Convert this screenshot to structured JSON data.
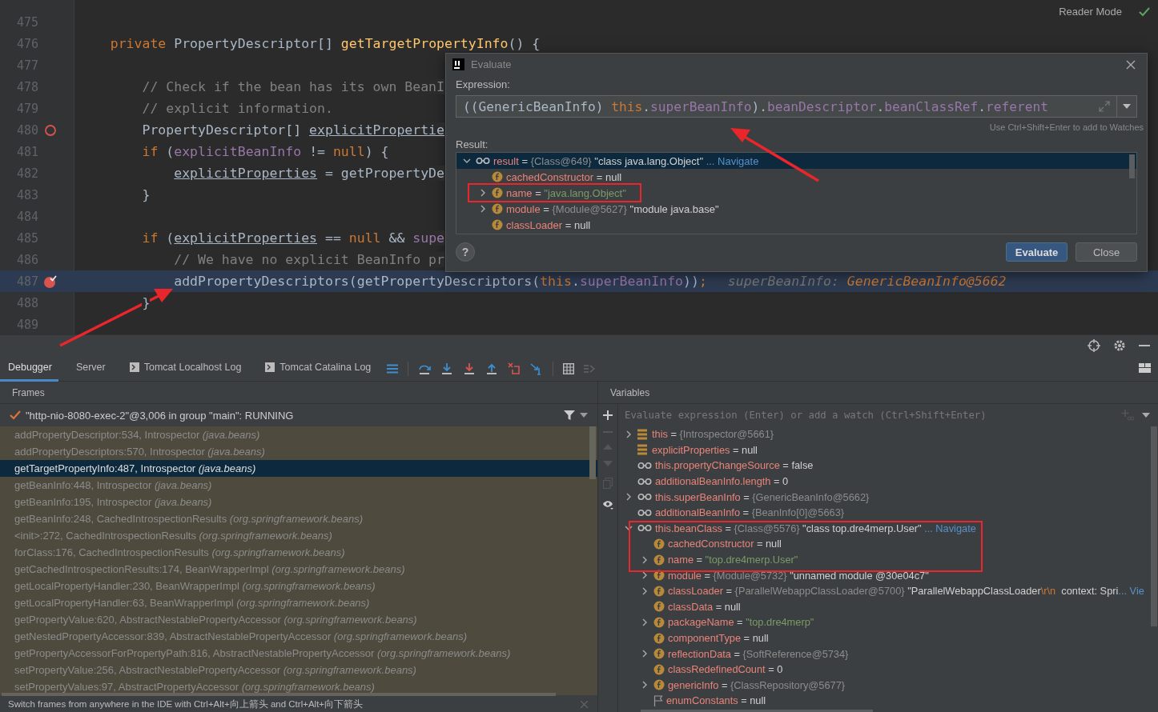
{
  "editor": {
    "reader_mode": "Reader Mode",
    "lines": [
      {
        "num": "475",
        "current": false
      },
      {
        "num": "476",
        "current": false,
        "tokens": [
          {
            "kind": "keyword",
            "t": "    private "
          },
          {
            "kind": "plain",
            "t": "PropertyDescriptor[] "
          },
          {
            "kind": "method",
            "t": "getTargetPropertyInfo"
          },
          {
            "kind": "plain",
            "t": "() {"
          }
        ]
      },
      {
        "num": "477",
        "current": false
      },
      {
        "num": "478",
        "current": false,
        "tokens": [
          {
            "kind": "comment",
            "t": "        // Check if the bean has its own BeanI"
          }
        ]
      },
      {
        "num": "479",
        "current": false,
        "tokens": [
          {
            "kind": "comment",
            "t": "        // explicit information."
          }
        ]
      },
      {
        "num": "480",
        "current": false,
        "breakpoint": true,
        "muted": true,
        "tokens": [
          {
            "kind": "plain",
            "t": "        PropertyDescriptor[] "
          },
          {
            "kind": "underline",
            "t": "explicitPropertie"
          }
        ]
      },
      {
        "num": "481",
        "current": false,
        "tokens": [
          {
            "kind": "keyword",
            "t": "        if "
          },
          {
            "kind": "plain",
            "t": "("
          },
          {
            "kind": "field",
            "t": "explicitBeanInfo"
          },
          {
            "kind": "plain",
            "t": " != "
          },
          {
            "kind": "keyword",
            "t": "null"
          },
          {
            "kind": "plain",
            "t": ") {"
          }
        ]
      },
      {
        "num": "482",
        "current": false,
        "tokens": [
          {
            "kind": "underline",
            "t": "            explicitProperties"
          },
          {
            "kind": "plain",
            "t": " = getPropertyDe"
          }
        ]
      },
      {
        "num": "483",
        "current": false,
        "tokens": [
          {
            "kind": "plain",
            "t": "        }"
          }
        ]
      },
      {
        "num": "484",
        "current": false
      },
      {
        "num": "485",
        "current": false,
        "tokens": [
          {
            "kind": "keyword",
            "t": "        if "
          },
          {
            "kind": "plain",
            "t": "("
          },
          {
            "kind": "underline",
            "t": "explicitProperties"
          },
          {
            "kind": "plain",
            "t": " == "
          },
          {
            "kind": "keyword",
            "t": "null"
          },
          {
            "kind": "plain",
            "t": " && "
          },
          {
            "kind": "field",
            "t": "supe"
          }
        ]
      },
      {
        "num": "486",
        "current": false,
        "tokens": [
          {
            "kind": "comment",
            "t": "            // We have no explicit BeanInfo pr"
          }
        ]
      },
      {
        "num": "487",
        "current": true,
        "breakpoint": true,
        "muted": false,
        "tokens": [
          {
            "kind": "plain",
            "t": "            addPropertyDescriptors(getPropertyDescriptors("
          },
          {
            "kind": "keyword",
            "t": "this"
          },
          {
            "kind": "plain",
            "t": "."
          },
          {
            "kind": "field",
            "t": "superBeanInfo"
          },
          {
            "kind": "plain",
            "t": "))"
          },
          {
            "kind": "keyword",
            "t": ";"
          },
          {
            "kind": "hint",
            "t": "superBeanInfo: "
          },
          {
            "kind": "hint-value",
            "t": "GenericBeanInfo@5662"
          }
        ]
      },
      {
        "num": "488",
        "current": false,
        "tokens": [
          {
            "kind": "plain",
            "t": "        }"
          }
        ]
      },
      {
        "num": "489",
        "current": false
      }
    ]
  },
  "dialog": {
    "title": "Evaluate",
    "expression_label": "Expression:",
    "expression": [
      {
        "kind": "plain",
        "t": "((GenericBeanInfo) "
      },
      {
        "kind": "keyword",
        "t": "this"
      },
      {
        "kind": "plain",
        "t": "."
      },
      {
        "kind": "field",
        "t": "superBeanInfo"
      },
      {
        "kind": "plain",
        "t": ")."
      },
      {
        "kind": "field",
        "t": "beanDescriptor"
      },
      {
        "kind": "plain",
        "t": "."
      },
      {
        "kind": "field",
        "t": "beanClassRef"
      },
      {
        "kind": "plain",
        "t": "."
      },
      {
        "kind": "field",
        "t": "referent"
      }
    ],
    "watch_hint": "Use Ctrl+Shift+Enter to add to Watches",
    "result_label": "Result:",
    "result": [
      {
        "kind": "watch",
        "name": "result",
        "expandable": true,
        "expanded": true,
        "selected": true,
        "value": [
          {
            "kind": "op",
            "t": " = "
          },
          {
            "kind": "ref",
            "t": "{Class@649} "
          },
          {
            "kind": "plain",
            "t": "\"class java.lang.Object\" "
          },
          {
            "kind": "link",
            "t": "... Navigate"
          }
        ],
        "children": [
          {
            "kind": "field",
            "name": "cachedConstructor",
            "expandable": false,
            "selected": false,
            "value": [
              {
                "kind": "op",
                "t": " = "
              },
              {
                "kind": "plain",
                "t": "null"
              }
            ]
          },
          {
            "kind": "field",
            "name": "name",
            "expandable": true,
            "expanded": false,
            "selected": false,
            "value": [
              {
                "kind": "op",
                "t": " = "
              },
              {
                "kind": "string",
                "t": "\"java.lang.Object\""
              }
            ]
          },
          {
            "kind": "field",
            "name": "module",
            "expandable": true,
            "expanded": false,
            "selected": false,
            "value": [
              {
                "kind": "op",
                "t": " = "
              },
              {
                "kind": "ref",
                "t": "{Module@5627} "
              },
              {
                "kind": "plain",
                "t": "\"module java.base\""
              }
            ]
          },
          {
            "kind": "field",
            "name": "classLoader",
            "expandable": false,
            "selected": false,
            "value": [
              {
                "kind": "op",
                "t": " = "
              },
              {
                "kind": "plain",
                "t": "null"
              }
            ]
          }
        ]
      }
    ],
    "buttons": [
      {
        "label": "Evaluate",
        "primary": true
      },
      {
        "label": "Close",
        "primary": false
      }
    ],
    "help": "?"
  },
  "debug": {
    "tabs": [
      {
        "label": "Debugger",
        "selected": true,
        "console": false
      },
      {
        "label": "Server",
        "selected": false,
        "console": false
      },
      {
        "label": "Tomcat Localhost Log",
        "selected": false,
        "console": true
      },
      {
        "label": "Tomcat Catalina Log",
        "selected": false,
        "console": true
      }
    ],
    "frames": {
      "title": "Frames",
      "thread": "\"http-nio-8080-exec-2\"@3,006 in group \"main\": RUNNING",
      "items": [
        {
          "method": "addPropertyDescriptor:534, Introspector",
          "package": "(java.beans)",
          "library": true,
          "selected": false
        },
        {
          "method": "addPropertyDescriptors:570, Introspector",
          "package": "(java.beans)",
          "library": true,
          "selected": false
        },
        {
          "method": "getTargetPropertyInfo:487, Introspector",
          "package": "(java.beans)",
          "library": false,
          "selected": true
        },
        {
          "method": "getBeanInfo:448, Introspector",
          "package": "(java.beans)",
          "library": true,
          "selected": false
        },
        {
          "method": "getBeanInfo:195, Introspector",
          "package": "(java.beans)",
          "library": true,
          "selected": false
        },
        {
          "method": "getBeanInfo:248, CachedIntrospectionResults",
          "package": "(org.springframework.beans)",
          "library": true,
          "selected": false
        },
        {
          "method": "<init>:272, CachedIntrospectionResults",
          "package": "(org.springframework.beans)",
          "library": true,
          "selected": false
        },
        {
          "method": "forClass:176, CachedIntrospectionResults",
          "package": "(org.springframework.beans)",
          "library": true,
          "selected": false
        },
        {
          "method": "getCachedIntrospectionResults:174, BeanWrapperImpl",
          "package": "(org.springframework.beans)",
          "library": true,
          "selected": false
        },
        {
          "method": "getLocalPropertyHandler:230, BeanWrapperImpl",
          "package": "(org.springframework.beans)",
          "library": true,
          "selected": false
        },
        {
          "method": "getLocalPropertyHandler:63, BeanWrapperImpl",
          "package": "(org.springframework.beans)",
          "library": true,
          "selected": false
        },
        {
          "method": "getPropertyValue:620, AbstractNestablePropertyAccessor",
          "package": "(org.springframework.beans)",
          "library": true,
          "selected": false
        },
        {
          "method": "getNestedPropertyAccessor:839, AbstractNestablePropertyAccessor",
          "package": "(org.springframework.beans)",
          "library": true,
          "selected": false
        },
        {
          "method": "getPropertyAccessorForPropertyPath:816, AbstractNestablePropertyAccessor",
          "package": "(org.springframework.beans)",
          "library": true,
          "selected": false
        },
        {
          "method": "setPropertyValue:256, AbstractNestablePropertyAccessor",
          "package": "(org.springframework.beans)",
          "library": true,
          "selected": false
        },
        {
          "method": "setPropertyValues:97, AbstractPropertyAccessor",
          "package": "(org.springframework.beans)",
          "library": true,
          "selected": false
        }
      ],
      "hint": "Switch frames from anywhere in the IDE with Ctrl+Alt+向上箭头 and Ctrl+Alt+向下箭头"
    },
    "variables": {
      "title": "Variables",
      "placeholder": "Evaluate expression (Enter) or add a watch (Ctrl+Shift+Enter)",
      "items": [
        {
          "kind": "local",
          "name": "this",
          "expandable": true,
          "expanded": false,
          "value": [
            {
              "kind": "op",
              "t": " = "
            },
            {
              "kind": "ref",
              "t": "{Introspector@5661}"
            }
          ]
        },
        {
          "kind": "local",
          "name": "explicitProperties",
          "expandable": false,
          "value": [
            {
              "kind": "op",
              "t": " = "
            },
            {
              "kind": "plain",
              "t": "null"
            }
          ]
        },
        {
          "kind": "watch",
          "name": "this.propertyChangeSource",
          "expandable": false,
          "value": [
            {
              "kind": "op",
              "t": " = "
            },
            {
              "kind": "plain",
              "t": "false"
            }
          ]
        },
        {
          "kind": "watch",
          "name": "additionalBeanInfo.length",
          "expandable": false,
          "value": [
            {
              "kind": "op",
              "t": " = "
            },
            {
              "kind": "plain",
              "t": "0"
            }
          ]
        },
        {
          "kind": "watch",
          "name": "this.superBeanInfo",
          "expandable": true,
          "expanded": false,
          "value": [
            {
              "kind": "op",
              "t": " = "
            },
            {
              "kind": "ref",
              "t": "{GenericBeanInfo@5662}"
            }
          ]
        },
        {
          "kind": "watch",
          "name": "additionalBeanInfo",
          "expandable": false,
          "value": [
            {
              "kind": "op",
              "t": " = "
            },
            {
              "kind": "ref",
              "t": "{BeanInfo[0]@5663}"
            }
          ]
        },
        {
          "kind": "watch",
          "name": "this.beanClass",
          "expandable": true,
          "expanded": true,
          "value": [
            {
              "kind": "op",
              "t": " = "
            },
            {
              "kind": "ref",
              "t": "{Class@5576} "
            },
            {
              "kind": "plain",
              "t": "\"class top.dre4merp.User\" "
            },
            {
              "kind": "link",
              "t": "... Navigate"
            }
          ],
          "children": [
            {
              "kind": "field",
              "name": "cachedConstructor",
              "expandable": false,
              "value": [
                {
                  "kind": "op",
                  "t": " = "
                },
                {
                  "kind": "plain",
                  "t": "null"
                }
              ]
            },
            {
              "kind": "field",
              "name": "name",
              "expandable": true,
              "expanded": false,
              "value": [
                {
                  "kind": "op",
                  "t": " = "
                },
                {
                  "kind": "string",
                  "t": "\"top.dre4merp.User\""
                }
              ]
            },
            {
              "kind": "field",
              "name": "module",
              "expandable": true,
              "expanded": false,
              "value": [
                {
                  "kind": "op",
                  "t": " = "
                },
                {
                  "kind": "ref",
                  "t": "{Module@5732} "
                },
                {
                  "kind": "plain",
                  "t": "\"unnamed module @30e04c7\""
                }
              ]
            },
            {
              "kind": "field",
              "name": "classLoader",
              "expandable": true,
              "expanded": false,
              "value": [
                {
                  "kind": "op",
                  "t": " = "
                },
                {
                  "kind": "ref",
                  "t": "{ParallelWebappClassLoader@5700} "
                },
                {
                  "kind": "plain",
                  "t": "\"ParallelWebappClassLoader"
                },
                {
                  "kind": "escape",
                  "t": "\\r\\n"
                },
                {
                  "kind": "plain",
                  "t": "  context: Spri"
                },
                {
                  "kind": "link",
                  "t": "... Vie"
                }
              ]
            },
            {
              "kind": "field",
              "name": "classData",
              "expandable": false,
              "value": [
                {
                  "kind": "op",
                  "t": " = "
                },
                {
                  "kind": "plain",
                  "t": "null"
                }
              ]
            },
            {
              "kind": "field",
              "name": "packageName",
              "expandable": true,
              "expanded": false,
              "value": [
                {
                  "kind": "op",
                  "t": " = "
                },
                {
                  "kind": "string",
                  "t": "\"top.dre4merp\""
                }
              ]
            },
            {
              "kind": "field",
              "name": "componentType",
              "expandable": false,
              "value": [
                {
                  "kind": "op",
                  "t": " = "
                },
                {
                  "kind": "plain",
                  "t": "null"
                }
              ]
            },
            {
              "kind": "field",
              "name": "reflectionData",
              "expandable": true,
              "expanded": false,
              "value": [
                {
                  "kind": "op",
                  "t": " = "
                },
                {
                  "kind": "ref",
                  "t": "{SoftReference@5734}"
                }
              ]
            },
            {
              "kind": "field",
              "name": "classRedefinedCount",
              "expandable": false,
              "value": [
                {
                  "kind": "op",
                  "t": " = "
                },
                {
                  "kind": "plain",
                  "t": "0"
                }
              ]
            },
            {
              "kind": "field",
              "name": "genericInfo",
              "expandable": true,
              "expanded": false,
              "value": [
                {
                  "kind": "op",
                  "t": " = "
                },
                {
                  "kind": "ref",
                  "t": "{ClassRepository@5677}"
                }
              ]
            },
            {
              "kind": "flag",
              "name": "enumConstants",
              "expandable": false,
              "value": [
                {
                  "kind": "op",
                  "t": " = "
                },
                {
                  "kind": "plain",
                  "t": "null"
                }
              ]
            }
          ]
        }
      ]
    }
  }
}
